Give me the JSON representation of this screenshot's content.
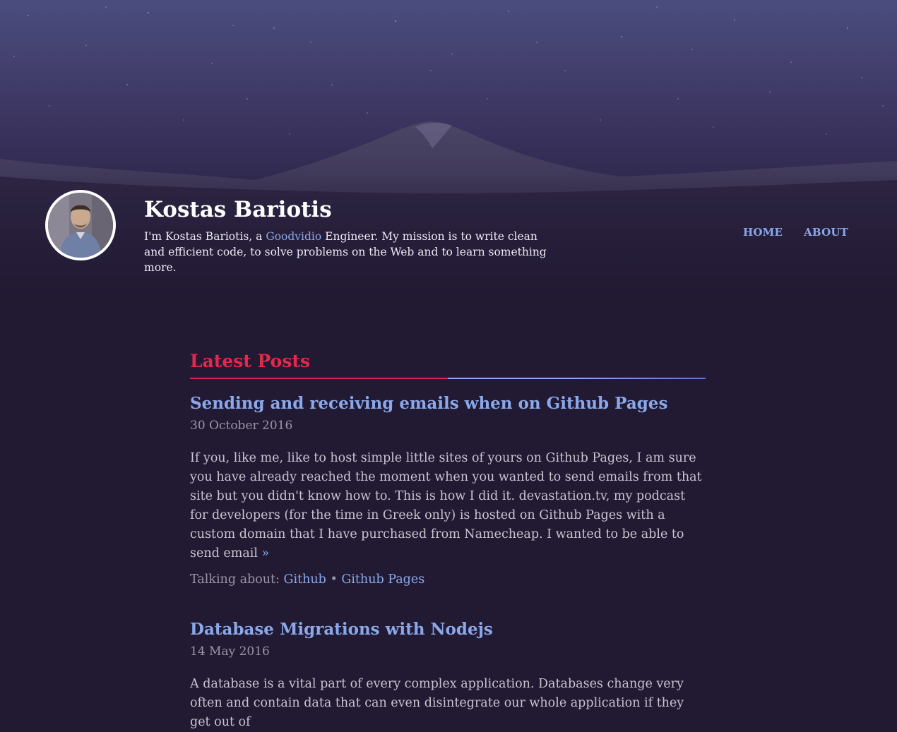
{
  "header": {
    "site_title": "Kostas Bariotis",
    "tagline_prefix": "I'm Kostas Bariotis, a ",
    "tagline_link": "Goodvidio",
    "tagline_suffix": " Engineer. My mission is to write clean and efficient code, to solve problems on the Web and to learn something more."
  },
  "nav": {
    "items": [
      {
        "label": "HOME"
      },
      {
        "label": "ABOUT"
      }
    ]
  },
  "main": {
    "section_title": "Latest Posts",
    "posts": [
      {
        "title": "Sending and receiving emails when on Github Pages",
        "date": "30 October 2016",
        "excerpt": "If you, like me, like to host simple little sites of yours on Github Pages, I am sure you have already reached the moment when you wanted to send emails from that site but you didn't know how to. This is how I did it. devastation.tv, my podcast for developers (for the time in Greek only) is hosted on Github Pages with a custom domain that I have purchased from Namecheap. I wanted to be able to send email ",
        "read_more": "»",
        "tags_label": "Talking about: ",
        "tags": [
          "Github",
          "Github Pages"
        ],
        "tag_separator": " • "
      },
      {
        "title": "Database Migrations with Nodejs",
        "date": "14 May 2016",
        "excerpt": "A database is a vital part of every complex application. Databases change very often and contain data that can even disintegrate our whole application if they get out of"
      }
    ]
  },
  "colors": {
    "background": "#221a33",
    "link": "#8aa8ea",
    "accent": "#e2294a",
    "muted": "#9a95a6"
  }
}
